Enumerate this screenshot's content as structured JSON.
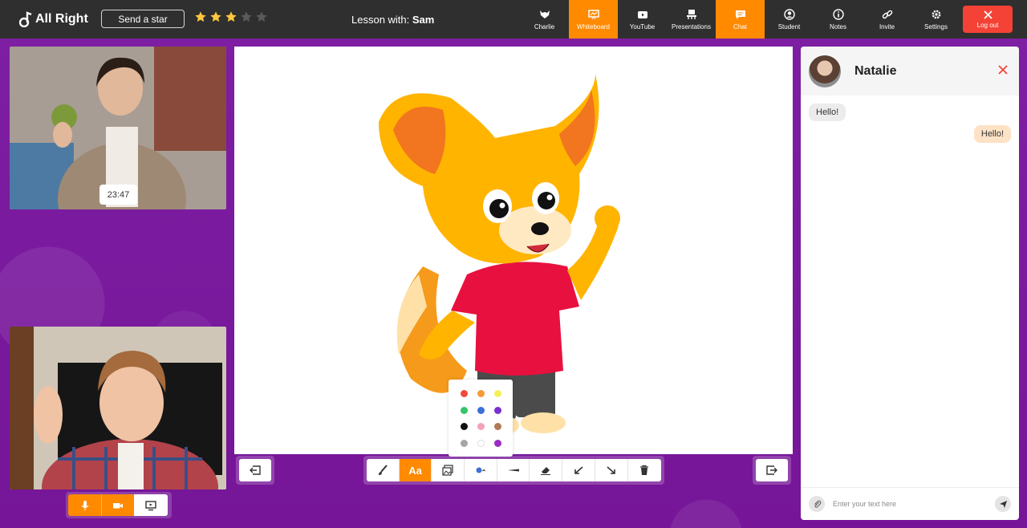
{
  "app": {
    "logo_text": "All Right",
    "send_star_label": "Send a star",
    "rating": {
      "filled": 3,
      "total": 5
    },
    "lesson_prefix": "Lesson with:",
    "lesson_name": "Sam"
  },
  "nav": [
    {
      "label": "Charlie",
      "icon": "fox-icon",
      "active": false
    },
    {
      "label": "Whiteboard",
      "icon": "whiteboard-icon",
      "active": true
    },
    {
      "label": "YouTube",
      "icon": "youtube-icon",
      "active": false
    },
    {
      "label": "Presentations",
      "icon": "presentation-icon",
      "active": false
    },
    {
      "label": "Chat",
      "icon": "chat-icon",
      "active": true
    },
    {
      "label": "Student",
      "icon": "student-icon",
      "active": false
    },
    {
      "label": "Notes",
      "icon": "info-icon",
      "active": false
    },
    {
      "label": "Invite",
      "icon": "link-icon",
      "active": false
    },
    {
      "label": "Settings",
      "icon": "gear-icon",
      "active": false
    }
  ],
  "logout_label": "Log out",
  "video": {
    "timer": "23:47"
  },
  "media_controls": [
    "microphone-icon",
    "camera-icon",
    "screen-share-icon"
  ],
  "whiteboard": {
    "toolbar": [
      {
        "name": "brush",
        "icon": "brush-icon"
      },
      {
        "name": "text",
        "label": "Aa",
        "active": true
      },
      {
        "name": "image",
        "icon": "image-icon"
      },
      {
        "name": "color",
        "icon": "color-dot-icon"
      },
      {
        "name": "line-width",
        "icon": "line-width-icon"
      },
      {
        "name": "eraser",
        "icon": "eraser-icon"
      },
      {
        "name": "undo",
        "icon": "undo-icon"
      },
      {
        "name": "redo",
        "icon": "redo-icon"
      },
      {
        "name": "delete",
        "icon": "trash-icon"
      }
    ],
    "palette": [
      "#f04b3a",
      "#f59a3c",
      "#f5f05a",
      "#34c46b",
      "#3d6fd6",
      "#7b2fd0",
      "#111111",
      "#f4a3b8",
      "#b07a55",
      "#a5a5a5",
      "#ffffff",
      "#9b2bc2"
    ],
    "selected_color": "#3d6fd6"
  },
  "colors": {
    "accent": "#ff8a00",
    "logout": "#f44336",
    "topbar": "#2f2f2f",
    "background": "#7a1a9c"
  },
  "chat": {
    "contact_name": "Natalie",
    "messages": [
      {
        "direction": "in",
        "text": "Hello!"
      },
      {
        "direction": "out",
        "text": "Hello!"
      }
    ],
    "input_placeholder": "Enter your text here"
  }
}
